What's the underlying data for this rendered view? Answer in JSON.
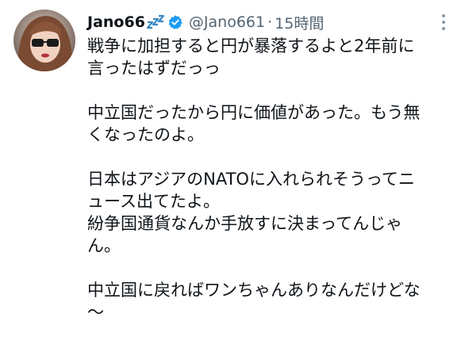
{
  "tweet": {
    "author": {
      "display_name": "Jano66",
      "name_emoji_icon": "zzz-emoji-icon",
      "verified_icon": "verified-badge-icon",
      "handle": "@Jano661",
      "separator": "·",
      "time": "15時間"
    },
    "more_icon": "more-vertical-icon",
    "lines": [
      "戦争に加担すると円が暴落するよと2年前に",
      "言ったはずだっっ",
      "",
      "中立国だったから円に価値があった。もう無",
      "くなったのよ。",
      "",
      "日本はアジアのNATOに入れられそうってニ",
      "ュース出てたよ。",
      "紛争国通貨なんか手放すに決まってんじゃ",
      "ん。",
      "",
      "中立国に戻ればワンちゃんありなんだけどな",
      "〜"
    ]
  },
  "colors": {
    "text_primary": "#0f1419",
    "text_secondary": "#536471",
    "verified_blue": "#1d9bf0",
    "zzz_blue": "#3b88c3"
  }
}
